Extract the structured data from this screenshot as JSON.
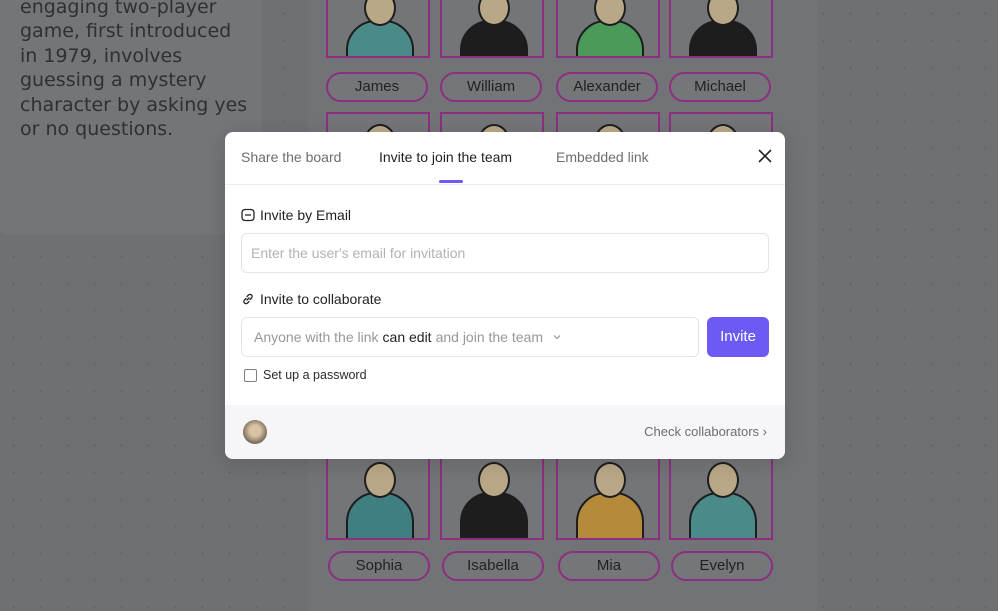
{
  "background": {
    "description_text": "engaging two-player game, first introduced in 1979, involves guessing a mystery character by asking yes or no questions.",
    "characters_top": [
      "James",
      "William",
      "Alexander",
      "Michael"
    ],
    "characters_bottom": [
      "Sophia",
      "Isabella",
      "Mia",
      "Evelyn"
    ]
  },
  "modal": {
    "tabs": [
      {
        "label": "Share the board",
        "active": false
      },
      {
        "label": "Invite to join the team",
        "active": true
      },
      {
        "label": "Embedded link",
        "active": false
      }
    ],
    "email_section": {
      "label": "Invite by Email",
      "icon": "mail-icon",
      "placeholder": "Enter the user's email for invitation",
      "value": ""
    },
    "collab_section": {
      "label": "Invite to collaborate",
      "icon": "link-icon",
      "prefix": "Anyone with the link",
      "permission": "can edit",
      "suffix": "and join the team",
      "invite_label": "Invite"
    },
    "password_checkbox": {
      "label": "Set up a password",
      "checked": false
    },
    "footer": {
      "check_collaborators": "Check collaborators"
    },
    "accent_color": "#6d5af5"
  }
}
